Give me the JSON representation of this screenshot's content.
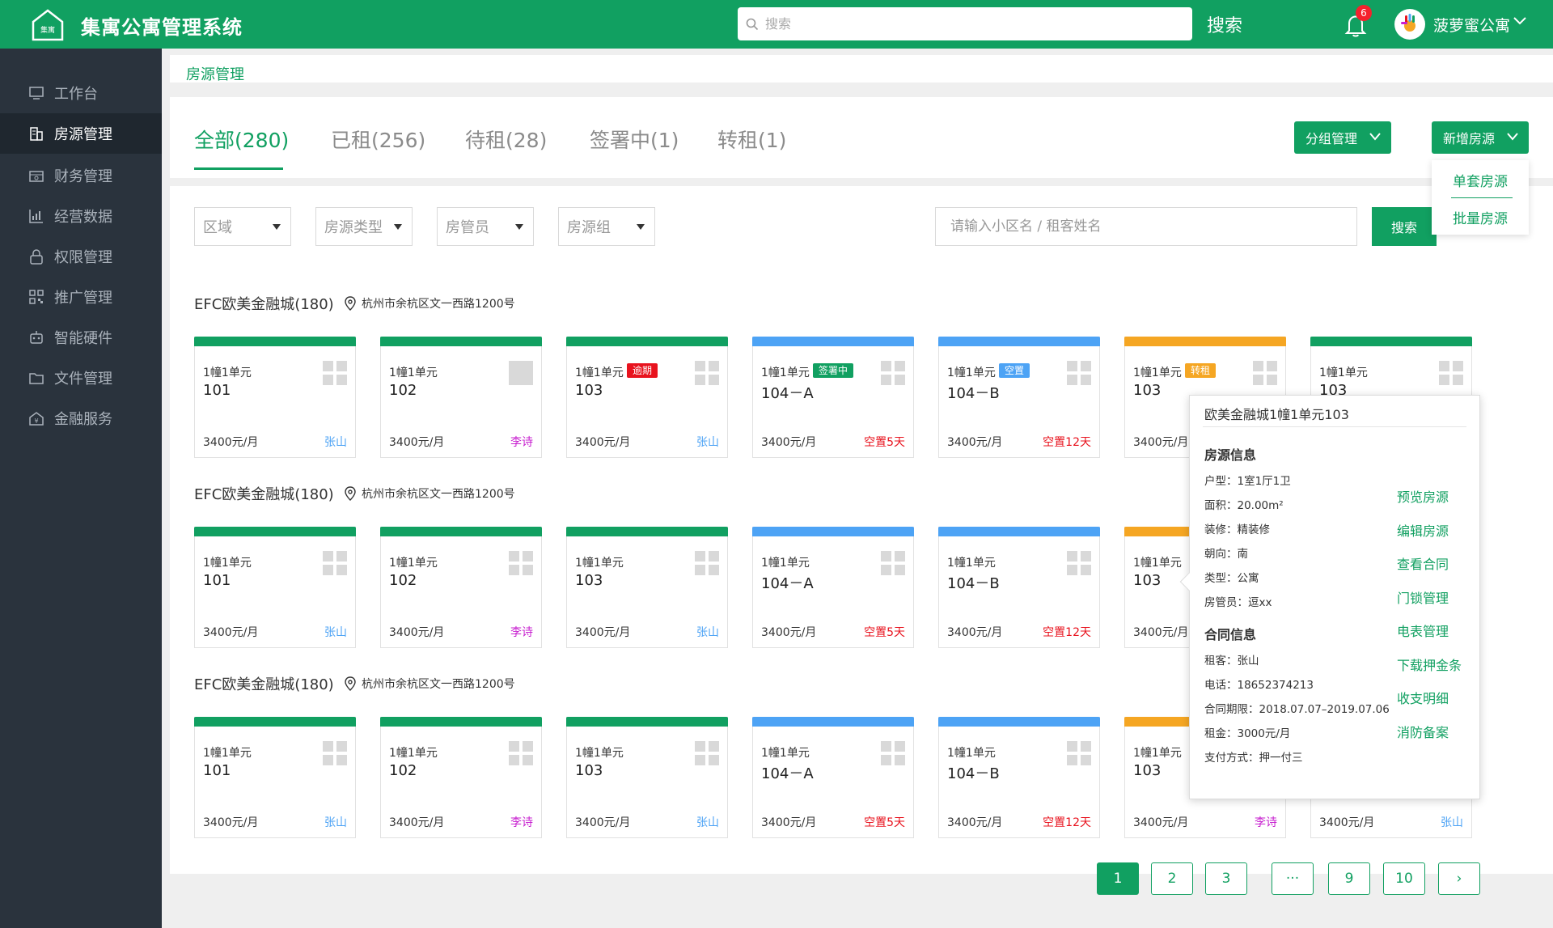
{
  "app": {
    "title": "集寓公寓管理系统",
    "logo_text": "集寓"
  },
  "header": {
    "search_placeholder": "搜索",
    "search_button": "搜索",
    "notification_count": "6",
    "user_name": "菠萝蜜公寓"
  },
  "sidebar": {
    "items": [
      {
        "label": "工作台",
        "icon": "monitor-icon"
      },
      {
        "label": "房源管理",
        "icon": "building-icon"
      },
      {
        "label": "财务管理",
        "icon": "wallet-icon"
      },
      {
        "label": "经营数据",
        "icon": "bar-chart-icon"
      },
      {
        "label": "权限管理",
        "icon": "lock-icon"
      },
      {
        "label": "推广管理",
        "icon": "qrcode-icon"
      },
      {
        "label": "智能硬件",
        "icon": "robot-icon"
      },
      {
        "label": "文件管理",
        "icon": "folder-icon"
      },
      {
        "label": "金融服务",
        "icon": "bank-icon"
      }
    ]
  },
  "breadcrumb": "房源管理",
  "tabs": [
    {
      "label": "全部(280)"
    },
    {
      "label": "已租(256)"
    },
    {
      "label": "待租(28)"
    },
    {
      "label": "签署中(1)"
    },
    {
      "label": "转租(1)"
    }
  ],
  "actions": {
    "group_manage": "分组管理",
    "add_house": "新增房源",
    "add_menu": [
      "单套房源",
      "批量房源"
    ]
  },
  "filters": {
    "selects": [
      "区域",
      "房源类型",
      "房管员",
      "房源组"
    ],
    "keyword_placeholder": "请输入小区名 / 租客姓名",
    "search_button": "搜索"
  },
  "groups": [
    {
      "title": "EFC欧美金融城(180)",
      "address": "杭州市余杭区文一西路1200号"
    },
    {
      "title": "EFC欧美金融城(180)",
      "address": "杭州市余杭区文一西路1200号"
    },
    {
      "title": "EFC欧美金融城(180)",
      "address": "杭州市余杭区文一西路1200号"
    }
  ],
  "status_colors": {
    "rented": "#11a061",
    "vacant": "#4da3f5",
    "sublet": "#f5a623",
    "overdue": "#e8131e",
    "signing": "#11a061",
    "vacant_tag": "#4da3f5"
  },
  "rooms": [
    [
      {
        "unit": "1幢1单元",
        "room": "101",
        "price": "3400元/月",
        "right": "张山",
        "right_color": "#4da3f5",
        "bar": "#11a061",
        "tag": "",
        "tag_color": ""
      },
      {
        "unit": "1幢1单元",
        "room": "102",
        "price": "3400元/月",
        "right": "李诗",
        "right_color": "#c71fcf",
        "bar": "#11a061",
        "tag": "",
        "tag_color": ""
      },
      {
        "unit": "1幢1单元",
        "room": "103",
        "price": "3400元/月",
        "right": "张山",
        "right_color": "#4da3f5",
        "bar": "#11a061",
        "tag": "逾期",
        "tag_color": "#e8131e"
      },
      {
        "unit": "1幢1单元",
        "room": "104－A",
        "price": "3400元/月",
        "right": "空置5天",
        "right_color": "#e8131e",
        "bar": "#4da3f5",
        "tag": "签署中",
        "tag_color": "#11a061"
      },
      {
        "unit": "1幢1单元",
        "room": "104－B",
        "price": "3400元/月",
        "right": "空置12天",
        "right_color": "#e8131e",
        "bar": "#4da3f5",
        "tag": "空置",
        "tag_color": "#4da3f5"
      },
      {
        "unit": "1幢1单元",
        "room": "103",
        "price": "3400元/月",
        "right": "",
        "right_color": "",
        "bar": "#f5a623",
        "tag": "转租",
        "tag_color": "#f5a623"
      },
      {
        "unit": "1幢1单元",
        "room": "103",
        "price": "",
        "right": "",
        "right_color": "",
        "bar": "#11a061",
        "tag": "",
        "tag_color": ""
      }
    ],
    [
      {
        "unit": "1幢1单元",
        "room": "101",
        "price": "3400元/月",
        "right": "张山",
        "right_color": "#4da3f5",
        "bar": "#11a061",
        "tag": "",
        "tag_color": ""
      },
      {
        "unit": "1幢1单元",
        "room": "102",
        "price": "3400元/月",
        "right": "李诗",
        "right_color": "#c71fcf",
        "bar": "#11a061",
        "tag": "",
        "tag_color": ""
      },
      {
        "unit": "1幢1单元",
        "room": "103",
        "price": "3400元/月",
        "right": "张山",
        "right_color": "#4da3f5",
        "bar": "#11a061",
        "tag": "",
        "tag_color": ""
      },
      {
        "unit": "1幢1单元",
        "room": "104－A",
        "price": "3400元/月",
        "right": "空置5天",
        "right_color": "#e8131e",
        "bar": "#4da3f5",
        "tag": "",
        "tag_color": ""
      },
      {
        "unit": "1幢1单元",
        "room": "104－B",
        "price": "3400元/月",
        "right": "空置12天",
        "right_color": "#e8131e",
        "bar": "#4da3f5",
        "tag": "",
        "tag_color": ""
      },
      {
        "unit": "1幢1单元",
        "room": "103",
        "price": "3400元/月",
        "right": "",
        "right_color": "",
        "bar": "#f5a623",
        "tag": "",
        "tag_color": ""
      }
    ],
    [
      {
        "unit": "1幢1单元",
        "room": "101",
        "price": "3400元/月",
        "right": "张山",
        "right_color": "#4da3f5",
        "bar": "#11a061",
        "tag": "",
        "tag_color": ""
      },
      {
        "unit": "1幢1单元",
        "room": "102",
        "price": "3400元/月",
        "right": "李诗",
        "right_color": "#c71fcf",
        "bar": "#11a061",
        "tag": "",
        "tag_color": ""
      },
      {
        "unit": "1幢1单元",
        "room": "103",
        "price": "3400元/月",
        "right": "张山",
        "right_color": "#4da3f5",
        "bar": "#11a061",
        "tag": "",
        "tag_color": ""
      },
      {
        "unit": "1幢1单元",
        "room": "104－A",
        "price": "3400元/月",
        "right": "空置5天",
        "right_color": "#e8131e",
        "bar": "#4da3f5",
        "tag": "",
        "tag_color": ""
      },
      {
        "unit": "1幢1单元",
        "room": "104－B",
        "price": "3400元/月",
        "right": "空置12天",
        "right_color": "#e8131e",
        "bar": "#4da3f5",
        "tag": "",
        "tag_color": ""
      },
      {
        "unit": "1幢1单元",
        "room": "103",
        "price": "3400元/月",
        "right": "李诗",
        "right_color": "#c71fcf",
        "bar": "#f5a623",
        "tag": "",
        "tag_color": ""
      },
      {
        "unit": "",
        "room": "",
        "price": "3400元/月",
        "right": "张山",
        "right_color": "#4da3f5",
        "bar": "#11a061",
        "tag": "",
        "tag_color": ""
      }
    ]
  ],
  "popover": {
    "title": "欧美金融城1幢1单元103",
    "house_section": "房源信息",
    "house_rows": [
      "户型：1室1厅1卫",
      "面积：20.00m²",
      "装修：精装修",
      "朝向：南",
      "类型：公寓",
      "房管员：逗xx"
    ],
    "contract_section": "合同信息",
    "contract_rows": [
      "租客：张山",
      "电话：18652374213",
      "合同期限：2018.07.07–2019.07.06",
      "租金：3000元/月",
      "支付方式：押一付三"
    ],
    "actions": [
      "预览房源",
      "编辑房源",
      "查看合同",
      "门锁管理",
      "电表管理",
      "下载押金条",
      "收支明细",
      "消防备案"
    ]
  },
  "pagination": [
    "1",
    "2",
    "3",
    "···",
    "9",
    "10",
    "›"
  ]
}
